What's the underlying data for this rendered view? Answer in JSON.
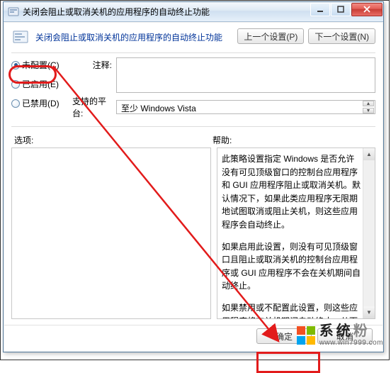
{
  "window": {
    "title": "关闭会阻止或取消关机的应用程序的自动终止功能",
    "header": "关闭会阻止或取消关机的应用程序的自动终止功能"
  },
  "nav": {
    "prev": "上一个设置(P)",
    "next": "下一个设置(N)"
  },
  "radio": {
    "not_configured": "未配置(C)",
    "enabled": "已启用(E)",
    "disabled": "已禁用(D)"
  },
  "labels": {
    "comment": "注释:",
    "supported": "支持的平台:"
  },
  "fields": {
    "comment_value": "",
    "supported_value": "至少 Windows Vista"
  },
  "sections": {
    "options": "选项:",
    "help": "帮助:"
  },
  "help": {
    "p1": "此策略设置指定 Windows 是否允许没有可见顶级窗口的控制台应用程序和 GUI 应用程序阻止或取消关机。默认情况下，如果此类应用程序无限期地试图取消或阻止关机，则这些应用程序会自动终止。",
    "p2": "如果启用此设置，则没有可见顶级窗口且阻止或取消关机的控制台应用程序或 GUI 应用程序不会在关机期间自动终止。",
    "p3": "如果禁用或不配置此设置，则这些应用程序将在关机期间自动终止，从而有助于确保 Windows 可以更快速、更顺利地关机。"
  },
  "buttons": {
    "ok": "确定",
    "cancel": "取消"
  },
  "watermark": {
    "brand_a": "系统",
    "brand_b": "粉",
    "url": "www.win7999.com"
  },
  "icons": {
    "app": "policy-dialog-icon",
    "minimize": "minimize-icon",
    "maximize": "maximize-icon",
    "close": "close-icon"
  }
}
